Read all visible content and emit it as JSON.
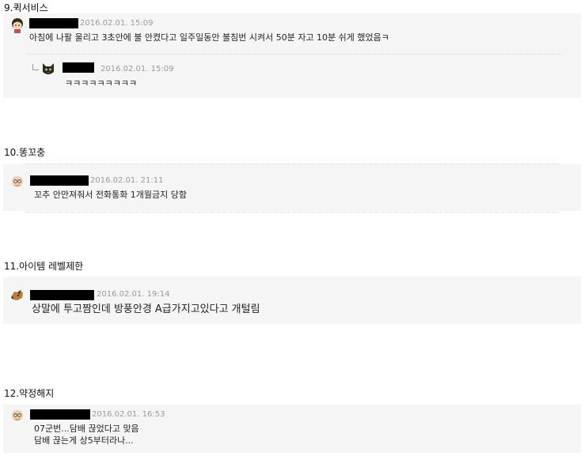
{
  "sections": [
    {
      "title": "9.퀵서비스",
      "comment": {
        "date": "2016.02.01. 15:09",
        "text": "아침에 나팔 울리고 3초안에 불 안켰다고 일주일동안 불침번 시켜서 50분 자고 10분 쉬게 했었음ㅋ"
      },
      "reply": {
        "date": "2016.02.01. 15:09",
        "text": "ㅋㅋㅋㅋㅋㅋㅋㅋㅋ"
      }
    },
    {
      "title": "10.똥꼬충",
      "comment": {
        "date": "2016.02.01. 21:11",
        "text": "꼬추 안만져줘서 전화통화 1개월금지 당함"
      }
    },
    {
      "title": "11.아이템 레벨제한",
      "comment": {
        "date": "2016.02.01. 19:14",
        "text": "상말에 투고짬인데 방풍안경 A급가지고있다고 개털림"
      }
    },
    {
      "title": "12.약정해지",
      "comment": {
        "date": "2016.02.01. 16:53",
        "lines": [
          "07군번...담배 끊었다고 맞음",
          "담배 끊는게 상5부터라나..."
        ]
      }
    }
  ],
  "icons": {
    "avatar_girl": "girl-avatar-icon",
    "avatar_cat": "black-cat-avatar-icon",
    "avatar_oldman": "old-man-avatar-icon",
    "avatar_dog": "dog-avatar-icon"
  }
}
